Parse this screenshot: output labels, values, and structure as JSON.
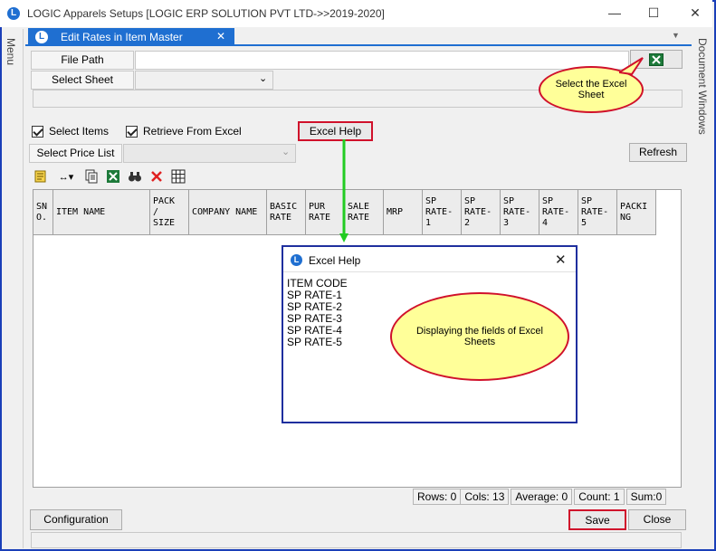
{
  "window": {
    "title": "LOGIC Apparels Setups  [LOGIC ERP SOLUTION PVT LTD->>2019-2020]",
    "logo": "L",
    "minimize": "—",
    "maximize": "☐",
    "close": "✕"
  },
  "rails": {
    "left": "Menu",
    "right": "Document Windows"
  },
  "tab": {
    "label": "Edit Rates in Item Master",
    "close": "✕",
    "arrow": "▼"
  },
  "form": {
    "file_path_label": "File Path",
    "file_path_value": "",
    "select_sheet_label": "Select Sheet",
    "select_sheet_value": "",
    "select_items_label": "Select Items",
    "retrieve_label": "Retrieve From Excel",
    "excel_help_label": "Excel Help",
    "select_price_list_label": "Select Price List",
    "select_price_list_value": "",
    "refresh_label": "Refresh"
  },
  "grid": {
    "columns": [
      "SN O.",
      "ITEM NAME",
      "PACK / SIZE",
      "COMPANY NAME",
      "BASIC RATE",
      "PUR RATE",
      "SALE RATE",
      "MRP",
      "SP RATE- 1",
      "SP RATE- 2",
      "SP RATE- 3",
      "SP RATE- 4",
      "SP RATE- 5",
      "PACKI NG"
    ]
  },
  "status": {
    "rows": "Rows: 0",
    "cols": "Cols: 13",
    "average": "Average: 0",
    "count": "Count: 1",
    "sum": "Sum:0"
  },
  "buttons": {
    "configuration": "Configuration",
    "save": "Save",
    "close": "Close"
  },
  "dialog": {
    "title": "Excel Help",
    "close": "✕",
    "items": [
      "ITEM CODE",
      "SP RATE-1",
      "SP RATE-2",
      "SP RATE-3",
      "SP RATE-4",
      "SP RATE-5"
    ]
  },
  "callouts": {
    "select_sheet": "Select the Excel Sheet",
    "fields": "Displaying the fields of Excel Sheets"
  },
  "colors": {
    "accent": "#1f6fd1",
    "highlight": "#d0112b",
    "arrow": "#22cc22",
    "callout_fill": "#ffff99"
  }
}
